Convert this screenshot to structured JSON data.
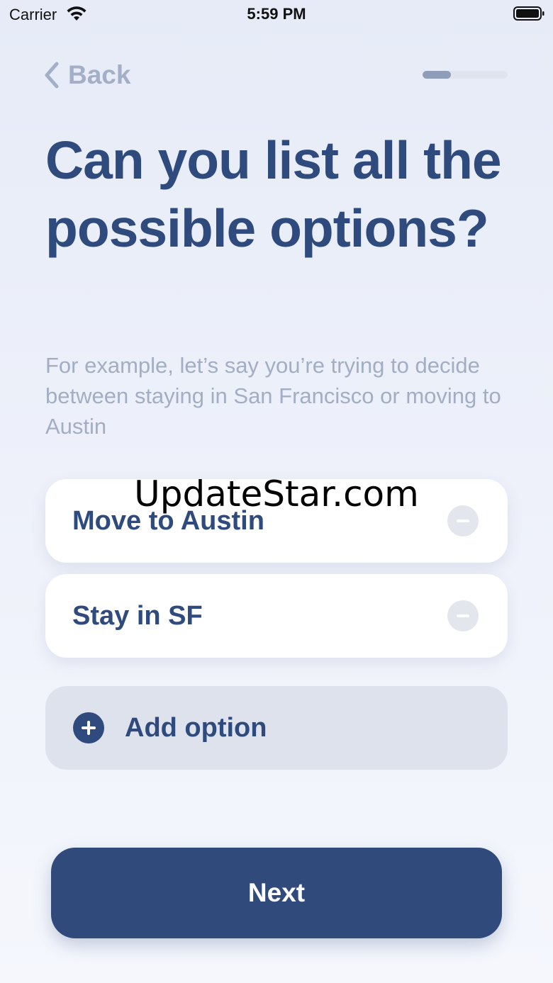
{
  "status_bar": {
    "carrier": "Carrier",
    "time": "5:59 PM",
    "wifi_icon": "wifi-icon",
    "battery_icon": "battery-icon"
  },
  "nav": {
    "back_label": "Back",
    "back_icon": "chevron-left-icon",
    "progress_fraction": 0.33
  },
  "title": "Can you list all the possible options?",
  "subtitle": "For example, let’s say you’re trying to decide between staying in San Francisco or moving to Austin",
  "options": [
    {
      "label": "Move to Austin",
      "remove_icon": "minus-circle-icon"
    },
    {
      "label": "Stay in SF",
      "remove_icon": "minus-circle-icon"
    }
  ],
  "add_option": {
    "label": "Add option",
    "icon": "plus-circle-icon"
  },
  "next_label": "Next",
  "watermark": "UpdateStar.com",
  "colors": {
    "primary": "#304a7b",
    "text": "#2f4a7c",
    "muted": "#a3aec4",
    "background": "#e6ebf7"
  }
}
